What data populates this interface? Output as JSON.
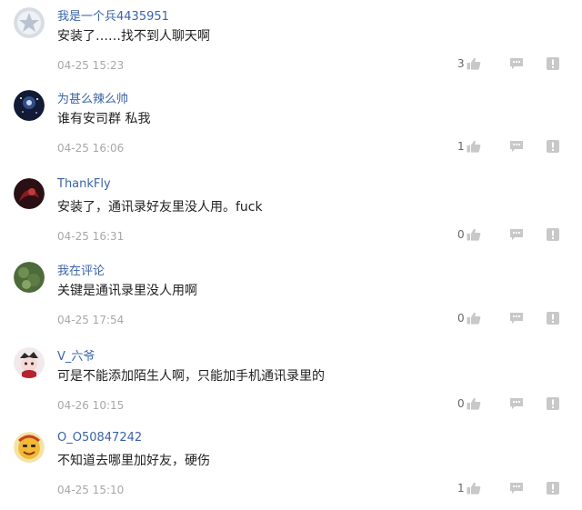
{
  "colors": {
    "username": "#3b63a6",
    "text": "#222222",
    "timestamp": "#a8a8a8",
    "icon": "#c8c8c8"
  },
  "comments": [
    {
      "username": "我是一个兵4435951",
      "content": "安装了……找不到人聊天啊",
      "time": "04-25 15:23",
      "likes": "3",
      "avatar": "silver-star-avatar"
    },
    {
      "username": "为甚么辣么帅",
      "content": "谁有安司群 私我",
      "time": "04-25 16:06",
      "likes": "1",
      "avatar": "night-sky-avatar"
    },
    {
      "username": "ThankFly",
      "content": "安装了，通讯录好友里没人用。fuck",
      "time": "04-25 16:31",
      "likes": "0",
      "avatar": "dark-red-avatar"
    },
    {
      "username": "我在评论",
      "content": "关键是通讯录里没人用啊",
      "time": "04-25 17:54",
      "likes": "0",
      "avatar": "green-foliage-avatar"
    },
    {
      "username": "V_六爷",
      "content": "可是不能添加陌生人啊，只能加手机通讯录里的",
      "time": "04-26 10:15",
      "likes": "0",
      "avatar": "cartoon-character-avatar"
    },
    {
      "username": "O_O50847242",
      "content": "不知道去哪里加好友，硬伤",
      "time": "04-25 15:10",
      "likes": "1",
      "avatar": "yellow-cartoon-avatar"
    }
  ]
}
